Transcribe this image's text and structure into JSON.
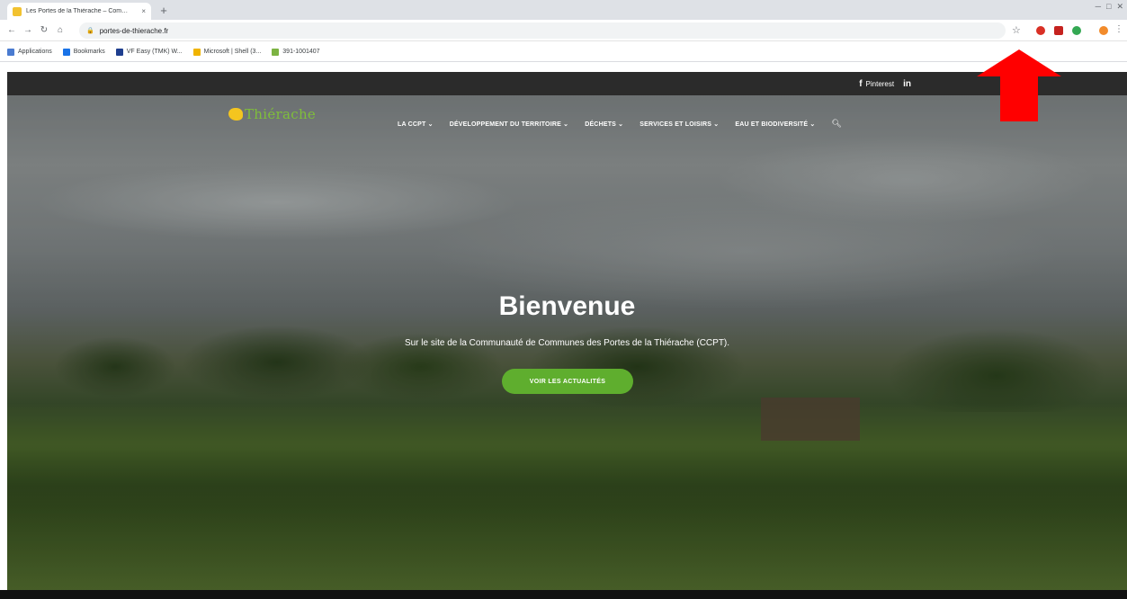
{
  "browser": {
    "tab_title": "Les Portes de la Thiérache – Com…",
    "tab_close": "×",
    "new_tab": "+",
    "url": "portes-de-thierache.fr",
    "bookmarks": [
      {
        "label": "Applications",
        "color": "#4a7bd0"
      },
      {
        "label": "Bookmarks",
        "color": "#1a73e8"
      },
      {
        "label": "VF Easy (TMK) W...",
        "color": "#1f3f8f"
      },
      {
        "label": "Microsoft | Shell (3...",
        "color": "#f0b400"
      },
      {
        "label": "391-1001407",
        "color": "#7cb342"
      }
    ],
    "extension_colors": [
      "#d93025",
      "#c5221f",
      "#34a853",
      "#f28b2b"
    ]
  },
  "site": {
    "topbar": {
      "facebook": "f",
      "pinterest": "Pinterest",
      "linkedin": "in"
    },
    "logo_text": "Thiérache",
    "nav": [
      "LA CCPT ⌄",
      "DÉVELOPPEMENT DU TERRITOIRE ⌄",
      "DÉCHETS ⌄",
      "SERVICES ET LOISIRS ⌄",
      "EAU ET BIODIVERSITÉ ⌄"
    ],
    "hero": {
      "title": "Bienvenue",
      "subtitle": "Sur le site de la Communauté de Communes des Portes de la Thiérache (CCPT).",
      "cta": "VOIR LES ACTUALITÉS"
    }
  },
  "annotation": {
    "arrow_color": "#ff0000"
  }
}
